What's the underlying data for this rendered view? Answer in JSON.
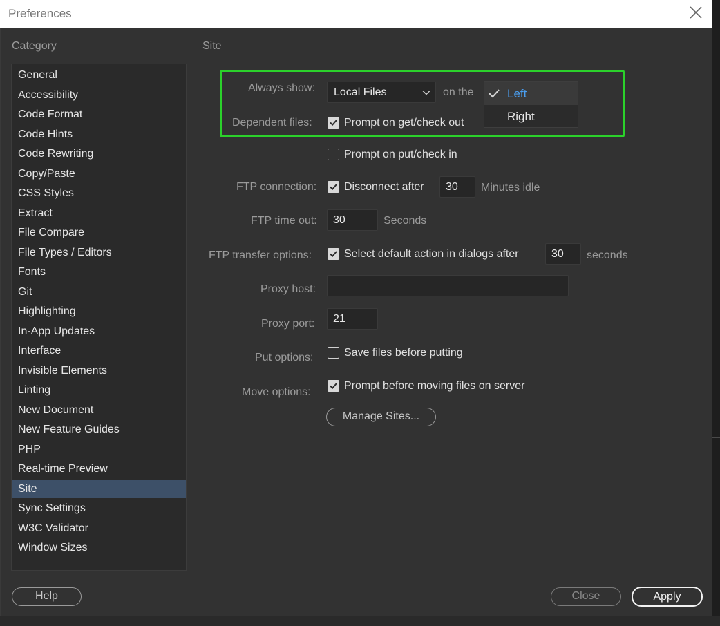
{
  "window": {
    "title": "Preferences"
  },
  "category": {
    "heading": "Category",
    "items": [
      "General",
      "Accessibility",
      "Code Format",
      "Code Hints",
      "Code Rewriting",
      "Copy/Paste",
      "CSS Styles",
      "Extract",
      "File Compare",
      "File Types / Editors",
      "Fonts",
      "Git",
      "Highlighting",
      "In-App Updates",
      "Interface",
      "Invisible Elements",
      "Linting",
      "New Document",
      "New Feature Guides",
      "PHP",
      "Real-time Preview",
      "Site",
      "Sync Settings",
      "W3C Validator",
      "Window Sizes"
    ],
    "selected": "Site"
  },
  "site": {
    "heading": "Site",
    "always_show": {
      "label": "Always show:",
      "value": "Local Files",
      "on_the": "on the"
    },
    "side_menu": {
      "options": [
        "Left",
        "Right"
      ],
      "selected": "Left"
    },
    "dependent": {
      "label": "Dependent files:",
      "get_label": "Prompt on get/check out",
      "get_checked": true,
      "put_label": "Prompt on put/check in",
      "put_checked": false
    },
    "ftp_connection": {
      "label": "FTP connection:",
      "checkbox_label": "Disconnect after",
      "checked": true,
      "value": "30",
      "suffix": "Minutes idle"
    },
    "ftp_timeout": {
      "label": "FTP time out:",
      "value": "30",
      "suffix": "Seconds"
    },
    "ftp_transfer": {
      "label": "FTP transfer options:",
      "checkbox_label": "Select default action in dialogs after",
      "checked": true,
      "value": "30",
      "suffix": "seconds"
    },
    "proxy_host": {
      "label": "Proxy host:",
      "value": ""
    },
    "proxy_port": {
      "label": "Proxy port:",
      "value": "21"
    },
    "put_options": {
      "label": "Put options:",
      "checkbox_label": "Save files before putting",
      "checked": false
    },
    "move_options": {
      "label": "Move options:",
      "checkbox_label": "Prompt before moving files on server",
      "checked": true
    },
    "manage_sites": "Manage Sites..."
  },
  "buttons": {
    "help": "Help",
    "close": "Close",
    "apply": "Apply"
  },
  "colors": {
    "highlight": "#2bd12b",
    "selection": "#3d5068",
    "menu_accent": "#4a9ef0"
  }
}
